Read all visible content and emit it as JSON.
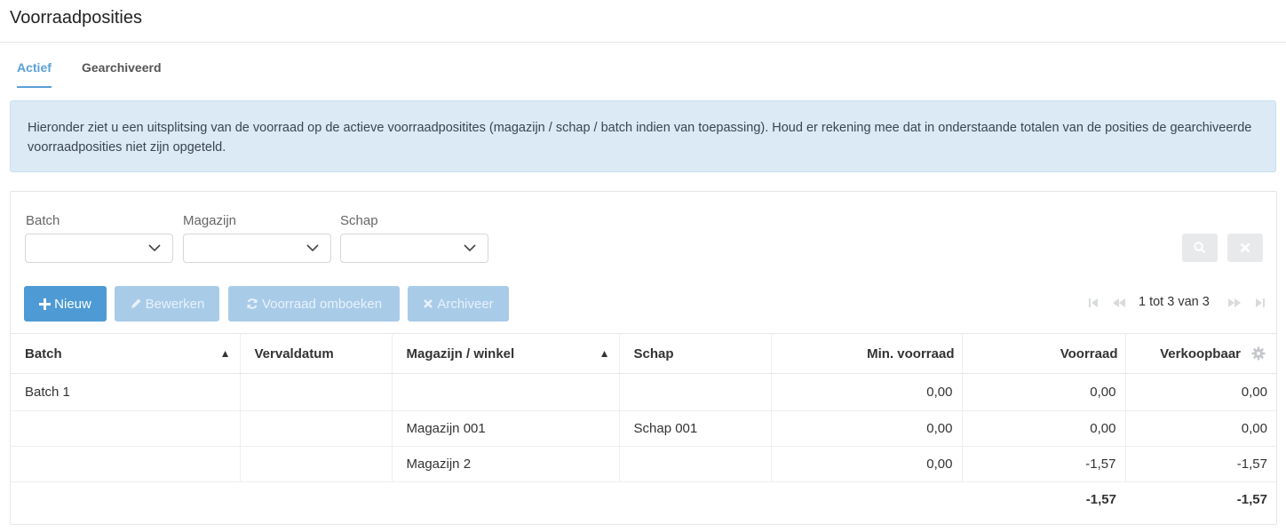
{
  "page": {
    "title": "Voorraadposities"
  },
  "tabs": [
    {
      "label": "Actief",
      "active": true
    },
    {
      "label": "Gearchiveerd",
      "active": false
    }
  ],
  "alert": {
    "text": "Hieronder ziet u een uitsplitsing van de voorraad op de actieve voorraadpositites (magazijn / schap / batch indien van toepassing). Houd er rekening mee dat in onderstaande totalen van de posities de gearchiveerde voorraadposities niet zijn opgeteld."
  },
  "filters": {
    "batch": {
      "label": "Batch",
      "value": ""
    },
    "magazijn": {
      "label": "Magazijn",
      "value": ""
    },
    "schap": {
      "label": "Schap",
      "value": ""
    },
    "search_icon": "search-icon",
    "clear_icon": "close-icon"
  },
  "toolbar": {
    "new_label": "Nieuw",
    "edit_label": "Bewerken",
    "rebook_label": "Voorraad omboeken",
    "archive_label": "Archiveer"
  },
  "pager": {
    "text": "1 tot 3 van 3"
  },
  "table": {
    "columns": [
      "Batch",
      "Vervaldatum",
      "Magazijn / winkel",
      "Schap",
      "Min. voorraad",
      "Voorraad",
      "Verkoopbaar"
    ],
    "rows": [
      [
        "Batch 1",
        "",
        "",
        "",
        "0,00",
        "0,00",
        "0,00"
      ],
      [
        "",
        "",
        "Magazijn 001",
        "Schap 001",
        "0,00",
        "0,00",
        "0,00"
      ],
      [
        "",
        "",
        "Magazijn 2",
        "",
        "0,00",
        "-1,57",
        "-1,57"
      ]
    ],
    "totals": {
      "voorraad": "-1,57",
      "verkoopbaar": "-1,57"
    }
  },
  "colors": {
    "accent": "#5aa0d6",
    "primary_button": "#4e9ad4",
    "disabled_button": "#a8cbe8",
    "alert_bg": "#dbeaf5"
  }
}
